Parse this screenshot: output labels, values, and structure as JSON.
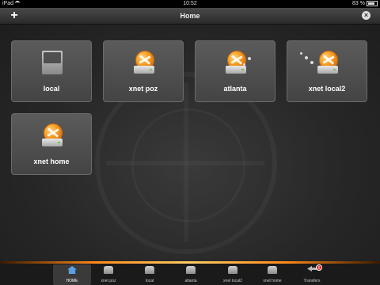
{
  "status": {
    "device": "iPad",
    "time": "10:52",
    "battery": "83 %",
    "battery_level": 0.83
  },
  "nav": {
    "title": "Home",
    "add": "+",
    "close": "×"
  },
  "servers": [
    {
      "label": "local",
      "icon": "hard-drive-icon"
    },
    {
      "label": "xnet poz",
      "icon": "globe-server-icon"
    },
    {
      "label": "atlanta",
      "icon": "globe-server-icon"
    },
    {
      "label": "xnet local2",
      "icon": "globe-server-icon"
    },
    {
      "label": "xnet home",
      "icon": "globe-server-icon"
    }
  ],
  "tabs": [
    {
      "label": "HOME",
      "active": true
    },
    {
      "label": "xnet poz"
    },
    {
      "label": "local"
    },
    {
      "label": "atlanta"
    },
    {
      "label": "xnet local2"
    },
    {
      "label": "xnet home"
    },
    {
      "label": "Transfers",
      "badge": "6"
    }
  ],
  "colors": {
    "accent": "#f39a1d",
    "background": "#262626",
    "tile": "#4f4f4f"
  }
}
